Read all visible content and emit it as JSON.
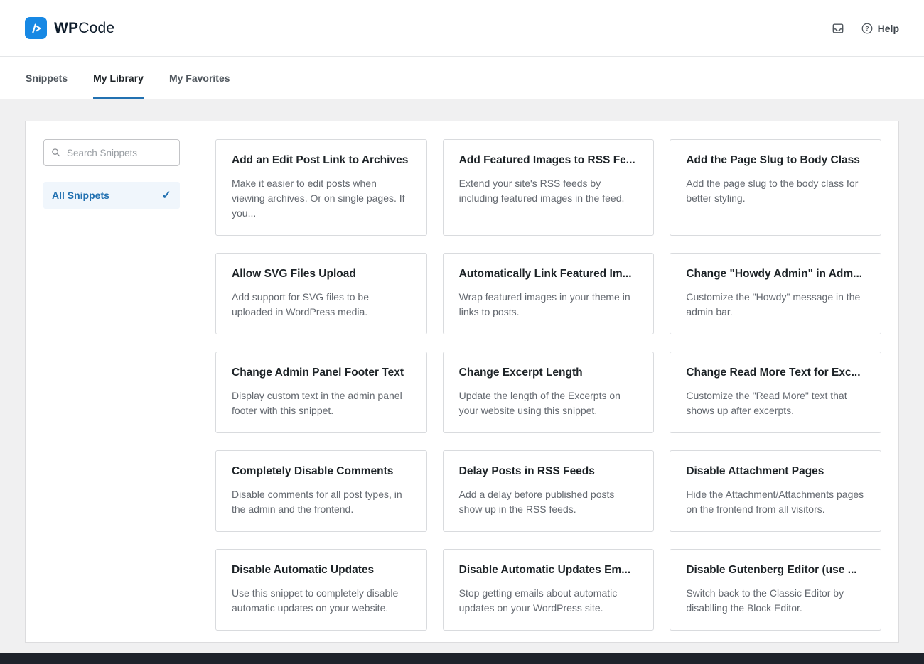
{
  "header": {
    "brand": {
      "wp": "WP",
      "code": "Code"
    },
    "help_label": "Help"
  },
  "tabs": [
    {
      "label": "Snippets",
      "active": false
    },
    {
      "label": "My Library",
      "active": true
    },
    {
      "label": "My Favorites",
      "active": false
    }
  ],
  "sidebar": {
    "search_placeholder": "Search Snippets",
    "items": [
      {
        "label": "All Snippets",
        "selected": true
      }
    ]
  },
  "snippets": [
    {
      "title": "Add an Edit Post Link to Archives",
      "description": "Make it easier to edit posts when viewing archives. Or on single pages. If you..."
    },
    {
      "title": "Add Featured Images to RSS Fe...",
      "description": "Extend your site's RSS feeds by including featured images in the feed."
    },
    {
      "title": "Add the Page Slug to Body Class",
      "description": "Add the page slug to the body class for better styling."
    },
    {
      "title": "Allow SVG Files Upload",
      "description": "Add support for SVG files to be uploaded in WordPress media."
    },
    {
      "title": "Automatically Link Featured Im...",
      "description": "Wrap featured images in your theme in links to posts."
    },
    {
      "title": "Change \"Howdy Admin\" in Adm...",
      "description": "Customize the \"Howdy\" message in the admin bar."
    },
    {
      "title": "Change Admin Panel Footer Text",
      "description": "Display custom text in the admin panel footer with this snippet."
    },
    {
      "title": "Change Excerpt Length",
      "description": "Update the length of the Excerpts on your website using this snippet."
    },
    {
      "title": "Change Read More Text for Exc...",
      "description": "Customize the \"Read More\" text that shows up after excerpts."
    },
    {
      "title": "Completely Disable Comments",
      "description": "Disable comments for all post types, in the admin and the frontend."
    },
    {
      "title": "Delay Posts in RSS Feeds",
      "description": "Add a delay before published posts show up in the RSS feeds."
    },
    {
      "title": "Disable Attachment Pages",
      "description": "Hide the Attachment/Attachments pages on the frontend from all visitors."
    },
    {
      "title": "Disable Automatic Updates",
      "description": "Use this snippet to completely disable automatic updates on your website."
    },
    {
      "title": "Disable Automatic Updates Em...",
      "description": "Stop getting emails about automatic updates on your WordPress site."
    },
    {
      "title": "Disable Gutenberg Editor (use ...",
      "description": "Switch back to the Classic Editor by disablling the Block Editor."
    }
  ],
  "colors": {
    "accent_blue": "#2271b1",
    "logo_blue": "#1788e4",
    "page_background": "#f0f0f1",
    "card_border": "#d9dbde",
    "text_primary": "#1d2327",
    "text_secondary": "#646970"
  }
}
